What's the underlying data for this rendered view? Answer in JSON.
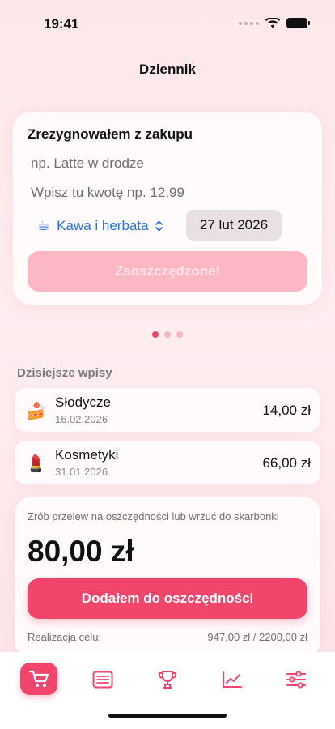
{
  "status": {
    "time": "19:41"
  },
  "nav": {
    "title": "Dziennik"
  },
  "entry_form": {
    "heading": "Zrezygnowałem z zakupu",
    "name_placeholder": "np. Latte w drodze",
    "amount_placeholder": "Wpisz tu kwotę np. 12,99",
    "category_emoji": "☕",
    "category": "Kawa i herbata",
    "date": "27 lut 2026",
    "save_label": "Zaoszczędzone!"
  },
  "pager": {
    "pages": 3,
    "active": 1
  },
  "today": {
    "label": "Dzisiejsze wpisy",
    "items": [
      {
        "emoji": "🍰",
        "name": "Słodycze",
        "date": "16.02.2026",
        "amount": "14,00 zł"
      },
      {
        "emoji": "💄",
        "name": "Kosmetyki",
        "date": "31.01.2026",
        "amount": "66,00 zł"
      }
    ]
  },
  "summary": {
    "hint": "Zrób przelew na oszczędności lub wrzuć do skarbonki",
    "total": "80,00 zł",
    "button_label": "Dodałem do oszczędności",
    "goal_label": "Realizacja celu:",
    "goal_value": "947,00 zł / 2200,00 zł"
  },
  "tabs": [
    {
      "icon": "cart-icon",
      "active": true
    },
    {
      "icon": "list-icon",
      "active": false
    },
    {
      "icon": "trophy-icon",
      "active": false
    },
    {
      "icon": "chart-icon",
      "active": false
    },
    {
      "icon": "sliders-icon",
      "active": false
    }
  ],
  "colors": {
    "accent": "#f2456b",
    "accent_light": "#fbb8c4",
    "link": "#2b6fe0"
  }
}
